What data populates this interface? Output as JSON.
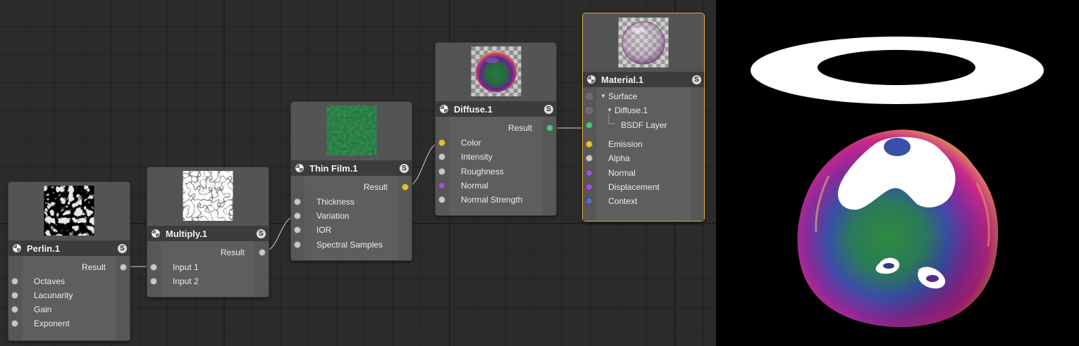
{
  "nodes": {
    "perlin": {
      "title": "Perlin.1",
      "output": "Result",
      "inputs": [
        "Octaves",
        "Lacunarity",
        "Gain",
        "Exponent"
      ]
    },
    "multiply": {
      "title": "Multiply.1",
      "output": "Result",
      "inputs": [
        "Input 1",
        "Input 2"
      ]
    },
    "thinfilm": {
      "title": "Thin Film.1",
      "output": "Result",
      "inputs": [
        "Thickness",
        "Variation",
        "IOR",
        "Spectral Samples"
      ]
    },
    "diffuse": {
      "title": "Diffuse.1",
      "output": "Result",
      "inputs": [
        "Color",
        "Intensity",
        "Roughness",
        "Normal",
        "Normal Strength"
      ]
    },
    "material": {
      "title": "Material.1",
      "surface": "Surface",
      "surface_child": "Diffuse.1",
      "surface_layer": "BSDF Layer",
      "inputs": [
        "Emission",
        "Alpha",
        "Normal",
        "Displacement",
        "Context"
      ]
    }
  },
  "header_badge": "S",
  "colors": {
    "color_port": "#e4c23a",
    "vector_port": "#9a57c9",
    "bsdf_port": "#4fc57a",
    "context_port": "#5a6fc2",
    "scalar_port": "#c8c8c8",
    "selection_outline": "#e0a93a"
  },
  "icons": [
    "node-type-icon",
    "solo-badge-icon",
    "expand-triangle-icon"
  ]
}
